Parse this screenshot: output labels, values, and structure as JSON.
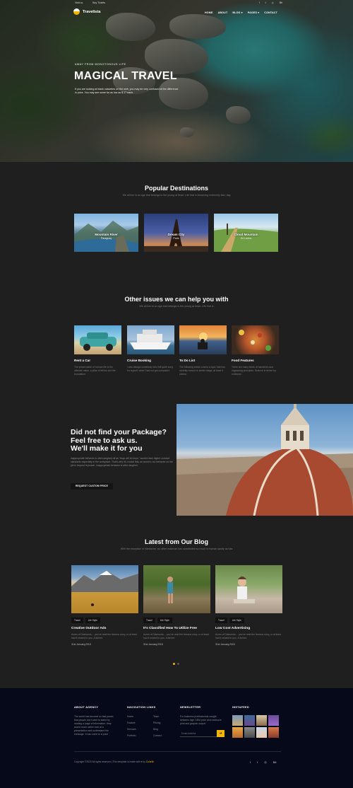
{
  "topbar": {
    "links": [
      "Visit us",
      "Buy Tickets"
    ],
    "social_icons": [
      "facebook-icon",
      "twitter-icon",
      "dribbble-icon",
      "behance-icon"
    ]
  },
  "brand": {
    "name": "Travelista",
    "accent": "#f2b600"
  },
  "nav": {
    "items": [
      "HOME",
      "ABOUT",
      "BLOG ▾",
      "PAGES ▾",
      "CONTACT"
    ]
  },
  "hero": {
    "kicker": "AWAY FROM MONOTONOUS LIFE",
    "title": "MAGICAL TRAVEL",
    "desc": "If you are looking at blank cassettes on the web, you may be very confused at the difference in price. You may see some for as low as $.17 each."
  },
  "destinations": {
    "title": "Popular Destinations",
    "subtitle": "We all live in an age that belongs to the young at heart. Life that is becoming extremely fast, day",
    "items": [
      {
        "name": "Mountain River",
        "sub": "Paraguay"
      },
      {
        "name": "Dream City",
        "sub": "Paris"
      },
      {
        "name": "Cloud Mountain",
        "sub": "Sri Lanka"
      }
    ]
  },
  "services": {
    "title": "Other issues we can help you with",
    "subtitle": "We all live in an age that belongs to the young at heart. Life that is",
    "items": [
      {
        "title": "Rent a Car",
        "desc": "The preservation of human life is the ultimate value, a pillar of ethics and the foundation."
      },
      {
        "title": "Cruise Booking",
        "desc": "I was always somebody who felt quite sorry for myself, what I had not got compared."
      },
      {
        "title": "To Do List",
        "desc": "The following article covers a topic that has recently moved to center stage–at least it seems."
      },
      {
        "title": "Food Features",
        "desc": "There are many kinds of narratives and organizing principles. Science is driven by evidence."
      }
    ]
  },
  "package": {
    "title_lines": [
      "Did not find your Package?",
      "Feel free to ask us.",
      "We'll make it for you"
    ],
    "desc": "inappropriate behavior is often laughed off as \"boys will be boys,\" women face higher conduct standards especially in the workplace. That's why it's crucial that, as women, our behavior on the job is beyond reproach. inappropriate behavior is often laughed.",
    "button": "REQUEST CUSTOM PRICE"
  },
  "blog": {
    "title": "Latest from Our Blog",
    "subtitle": "With the exception of Nietzsche, no other madman has contributed so much to human sanity as has",
    "posts": [
      {
        "tags": [
          "Travel",
          "Life Style"
        ],
        "title": "Creative Outdoor Ads",
        "desc": "Acres of Diamonds… you've read the famous story, or at least had it related to you. A farmer.",
        "date": "31st January,2018"
      },
      {
        "tags": [
          "Travel",
          "Life Style"
        ],
        "title": "It's Classified How To Utilize Free",
        "desc": "Acres of Diamonds… you've read the famous story, or at least had it related to you. A farmer.",
        "date": "31st January,2018"
      },
      {
        "tags": [
          "Travel",
          "Life Style"
        ],
        "title": "Low Cost Advertising",
        "desc": "Acres of Diamonds… you've read the famous story, or at least had it related to you. A farmer.",
        "date": "31st January,2018"
      }
    ]
  },
  "footer": {
    "about": {
      "heading": "ABOUT AGENCY",
      "text": "The world has become so fast paced that people don't want to stand by reading a page of information, they would much rather look at a presentation and understand the message. It has come to a point"
    },
    "navigation": {
      "heading": "NAVIGATION LINKS",
      "col1": [
        "Home",
        "Feature",
        "Services",
        "Portfolio"
      ],
      "col2": [
        "Team",
        "Pricing",
        "Blog",
        "Contact"
      ]
    },
    "newsletter": {
      "heading": "NEWSLETTER",
      "text": "For business professionals caught between high OEM price and mediocre print and graphic output.",
      "placeholder": "Email Address"
    },
    "instafeed": {
      "heading": "INSTAFEED"
    },
    "copyright": "Copyright ©2020 All rights reserved | This template is made with ♥ by",
    "copyright_brand": "Colorlib",
    "social_icons": [
      "facebook-icon",
      "twitter-icon",
      "dribbble-icon",
      "behance-icon"
    ]
  }
}
